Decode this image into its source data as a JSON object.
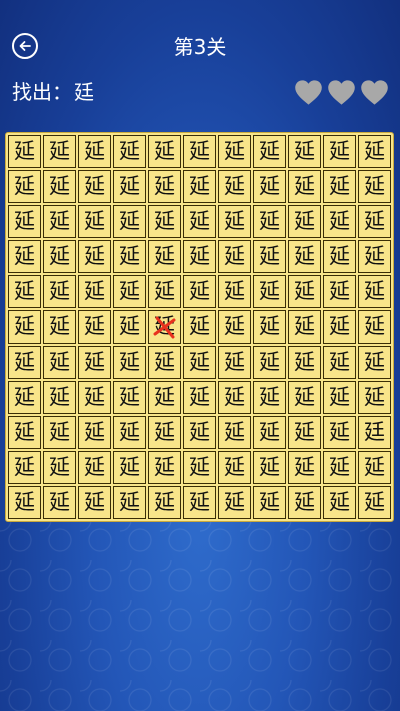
{
  "header": {
    "title": "第3关"
  },
  "task": {
    "prompt": "找出：",
    "target": "廷"
  },
  "lives": {
    "total": 3,
    "icon": "heart-icon",
    "color": "#a8a8a8"
  },
  "board": {
    "rows": 11,
    "cols": 11,
    "fill_char": "延",
    "odd_char": "廷",
    "odd_cell": {
      "row": 8,
      "col": 10
    },
    "wrong_mark_cell": {
      "row": 5,
      "col": 4
    },
    "wrong_mark_color": "#e8321e",
    "tile_color": "#f8e58a"
  }
}
